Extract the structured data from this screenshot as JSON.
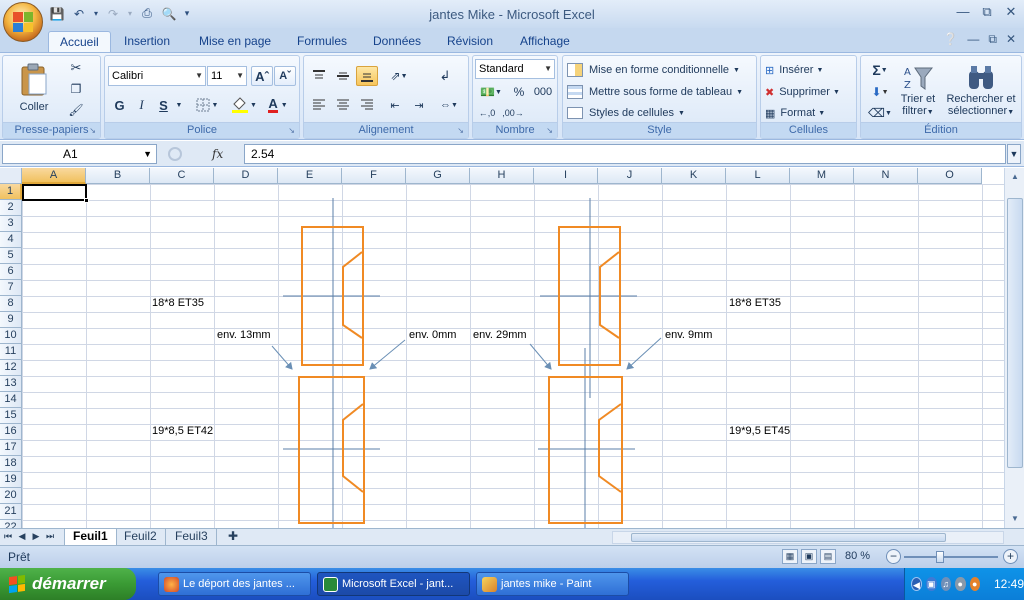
{
  "window": {
    "title": "jantes Mike - Microsoft Excel"
  },
  "ribbon_tabs": [
    "Accueil",
    "Insertion",
    "Mise en page",
    "Formules",
    "Données",
    "Révision",
    "Affichage"
  ],
  "groups": {
    "clipboard": {
      "label": "Presse-papiers",
      "paste": "Coller"
    },
    "font": {
      "label": "Police",
      "font_name": "Calibri",
      "font_size": "11",
      "bold": "G",
      "italic": "I",
      "underline": "S"
    },
    "alignment": {
      "label": "Alignement"
    },
    "number": {
      "label": "Nombre",
      "format": "Standard",
      "percent": "%",
      "thousands": "000"
    },
    "style": {
      "label": "Style",
      "conditional": "Mise en forme conditionnelle",
      "table": "Mettre sous forme de tableau",
      "cell_styles": "Styles de cellules"
    },
    "cells": {
      "label": "Cellules",
      "insert": "Insérer",
      "delete": "Supprimer",
      "format": "Format"
    },
    "editing": {
      "label": "Édition",
      "sort_line1": "Trier et",
      "sort_line2": "filtrer",
      "find_line1": "Rechercher et",
      "find_line2": "sélectionner"
    }
  },
  "formula_bar": {
    "name_box": "A1",
    "fx": "fx",
    "value": "2.54"
  },
  "columns": [
    "A",
    "B",
    "C",
    "D",
    "E",
    "F",
    "G",
    "H",
    "I",
    "J",
    "K",
    "L",
    "M",
    "N",
    "O"
  ],
  "rows": [
    "1",
    "2",
    "3",
    "4",
    "5",
    "6",
    "7",
    "8",
    "9",
    "10",
    "11",
    "12",
    "13",
    "14",
    "15",
    "16",
    "17",
    "18",
    "19",
    "20",
    "21",
    "22"
  ],
  "cell_texts": {
    "c8": "18*8 ET35",
    "c16": "19*8,5 ET42",
    "l8": "18*8 ET35",
    "l16": "19*9,5 ET45",
    "d10": "env. 13mm",
    "g10": "env. 0mm",
    "h10": "env. 29mm",
    "k10": "env. 9mm"
  },
  "sheets": [
    "Feuil1",
    "Feuil2",
    "Feuil3"
  ],
  "status": {
    "ready": "Prêt",
    "zoom": "80 %"
  },
  "taskbar": {
    "start": "démarrer",
    "tasks": [
      "Le déport des jantes ...",
      "Microsoft Excel - jant...",
      "jantes mike - Paint"
    ],
    "clock": "12:49"
  },
  "colors": {
    "drawing_orange": "#f08a24",
    "drawing_axis": "#5b7fa8",
    "arrow": "#6a8fb5"
  }
}
